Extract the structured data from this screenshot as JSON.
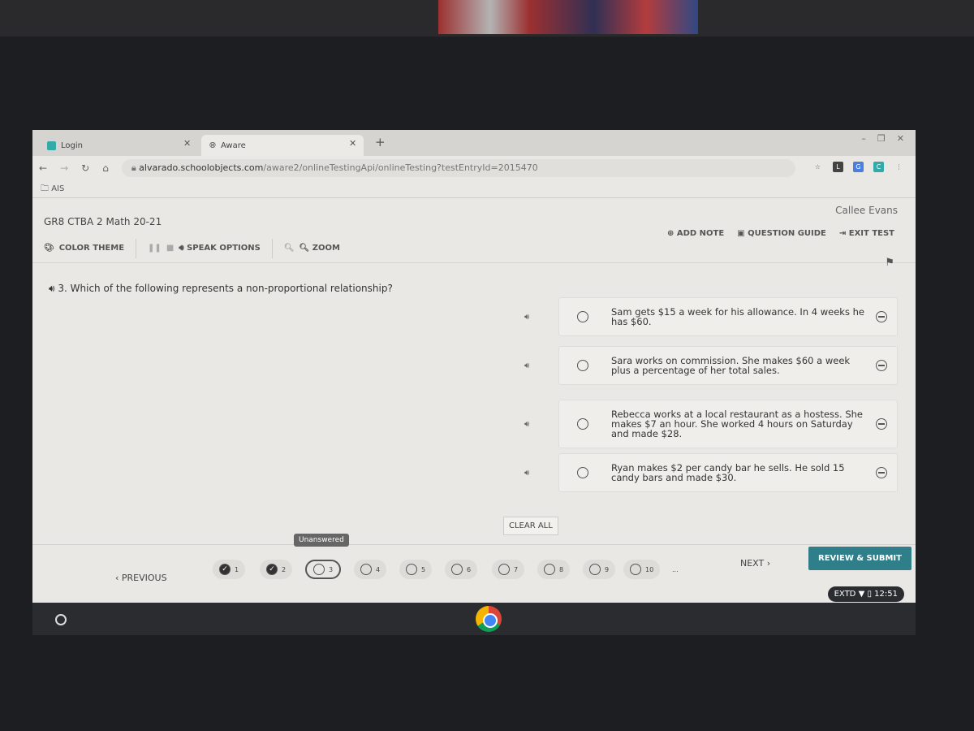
{
  "browser": {
    "tabs": [
      {
        "label": "Login"
      },
      {
        "label": "Aware"
      }
    ],
    "new_tab": "+",
    "url_domain": "alvarado.schoolobjects.com",
    "url_path": "/aware2/onlineTestingApi/onlineTesting?testEntryId=2015470",
    "bookmark": "AIS",
    "extensions": [
      "L",
      "G",
      "C"
    ]
  },
  "header": {
    "title": "GR8 CTBA 2 Math 20-21",
    "user": "Callee Evans"
  },
  "toolbar": {
    "color_theme": "COLOR THEME",
    "speak_options": "SPEAK OPTIONS",
    "zoom": "ZOOM",
    "add_note": "ADD NOTE",
    "question_guide": "QUESTION GUIDE",
    "exit_test": "EXIT TEST"
  },
  "question": {
    "text": "3. Which of the following represents a non-proportional relationship?",
    "answers": [
      "Sam gets $15 a week for his allowance. In 4 weeks he has $60.",
      "Sara works on commission. She makes $60 a week plus a percentage of her total sales.",
      "Rebecca works at a local restaurant as a hostess. She makes $7 an hour. She worked 4 hours on Saturday and made $28.",
      "Ryan makes $2 per candy bar he sells. He sold 15 candy bars and made $30."
    ],
    "clear_all": "CLEAR ALL"
  },
  "nav": {
    "previous": "PREVIOUS",
    "next": "NEXT",
    "review": "REVIEW & SUBMIT",
    "tooltip": "Unanswered",
    "questions": [
      "1",
      "2",
      "3",
      "4",
      "5",
      "6",
      "7",
      "8",
      "9",
      "10"
    ],
    "answered": [
      true,
      true,
      false,
      false,
      false,
      false,
      false,
      false,
      false,
      false
    ],
    "current": "3",
    "more": "..."
  },
  "shelf": {
    "ime": "EXTD",
    "time": "12:51"
  },
  "colors": {
    "accent": "#2e7f8a"
  }
}
